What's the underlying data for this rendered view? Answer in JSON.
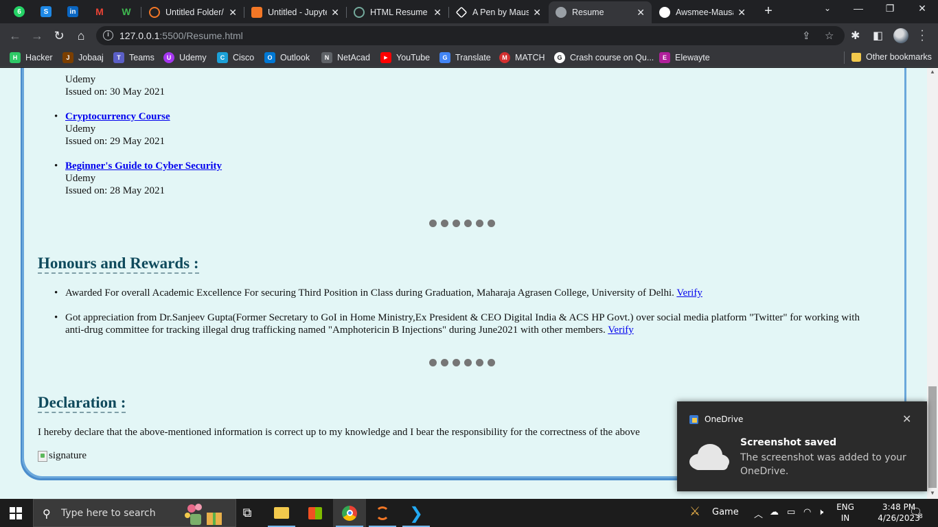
{
  "browser": {
    "tabs": [
      {
        "title": "Untitled Folder/",
        "fav_color": "#f37726"
      },
      {
        "title": "Untitled - Jupyter",
        "fav_color": "#f37726"
      },
      {
        "title": "HTML Resume Generator",
        "fav_color": "#74aa9c"
      },
      {
        "title": "A Pen by Mausam",
        "fav_color": "#ffffff"
      },
      {
        "title": "Resume",
        "fav_color": "#9aa0a6",
        "active": true
      },
      {
        "title": "Awsmee-Mausam",
        "fav_color": "#ffffff"
      }
    ],
    "url_host": "127.0.0.1",
    "url_rest": ":5500/Resume.html",
    "bookmarks": [
      {
        "label": "Hacker",
        "icon_color": "#2ec866",
        "glyph": "H"
      },
      {
        "label": "Jobaaj",
        "icon_color": "#7b3f00",
        "glyph": "J"
      },
      {
        "label": "Teams",
        "icon_color": "#5b5fc7",
        "glyph": "T"
      },
      {
        "label": "Udemy",
        "icon_color": "#a435f0",
        "glyph": "U"
      },
      {
        "label": "Cisco",
        "icon_color": "#1ba0d7",
        "glyph": "C"
      },
      {
        "label": "Outlook",
        "icon_color": "#0078d4",
        "glyph": "O"
      },
      {
        "label": "NetAcad",
        "icon_color": "#5f6368",
        "glyph": "N"
      },
      {
        "label": "YouTube",
        "icon_color": "#ff0000",
        "glyph": "▶"
      },
      {
        "label": "Translate",
        "icon_color": "#4285f4",
        "glyph": "G"
      },
      {
        "label": "MATCH",
        "icon_color": "#d32f2f",
        "glyph": "M"
      },
      {
        "label": "Crash course on Qu...",
        "icon_color": "#ffffff",
        "glyph": "G"
      },
      {
        "label": "Elewayte",
        "icon_color": "#b0209b",
        "glyph": "E"
      }
    ],
    "other_bookmarks": "Other bookmarks"
  },
  "page": {
    "certifications": [
      {
        "provider": "Udemy",
        "issued": "Issued on: 30 May 2021"
      },
      {
        "title": "Cryptocurrency Course",
        "provider": "Udemy",
        "issued": "Issued on: 29 May 2021"
      },
      {
        "title": "Beginner's Guide to Cyber Security",
        "provider": "Udemy",
        "issued": "Issued on: 28 May 2021"
      }
    ],
    "honours_title": "Honours and Rewards :",
    "honours": [
      {
        "text": "Awarded For overall Academic Excellence For securing Third Position in Class during Graduation, Maharaja Agrasen College, University of Delhi. ",
        "link": "Verify"
      },
      {
        "text": "Got appreciation from Dr.Sanjeev Gupta(Former Secretary to GoI in Home Ministry,Ex President & CEO Digital India & ACS HP Govt.) over social media platform \"Twitter\" for working with anti-drug committee for tracking illegal drug trafficking named \"Amphotericin B Injections\" during June2021 with other members. ",
        "link": "Verify"
      }
    ],
    "declaration_title": "Declaration :",
    "declaration_text": "I hereby declare that the above-mentioned information is correct up to my knowledge and I bear the responsibility for the correctness of the above",
    "signature_alt": "signature"
  },
  "toast": {
    "app": "OneDrive",
    "title": "Screenshot saved",
    "body": "The screenshot was added to your OneDrive."
  },
  "taskbar": {
    "search_placeholder": "Type here to search",
    "game_label": "Game",
    "lang_line1": "ENG",
    "lang_line2": "IN",
    "time": "3:48 PM",
    "date": "4/26/2023",
    "notif_count": "8"
  }
}
